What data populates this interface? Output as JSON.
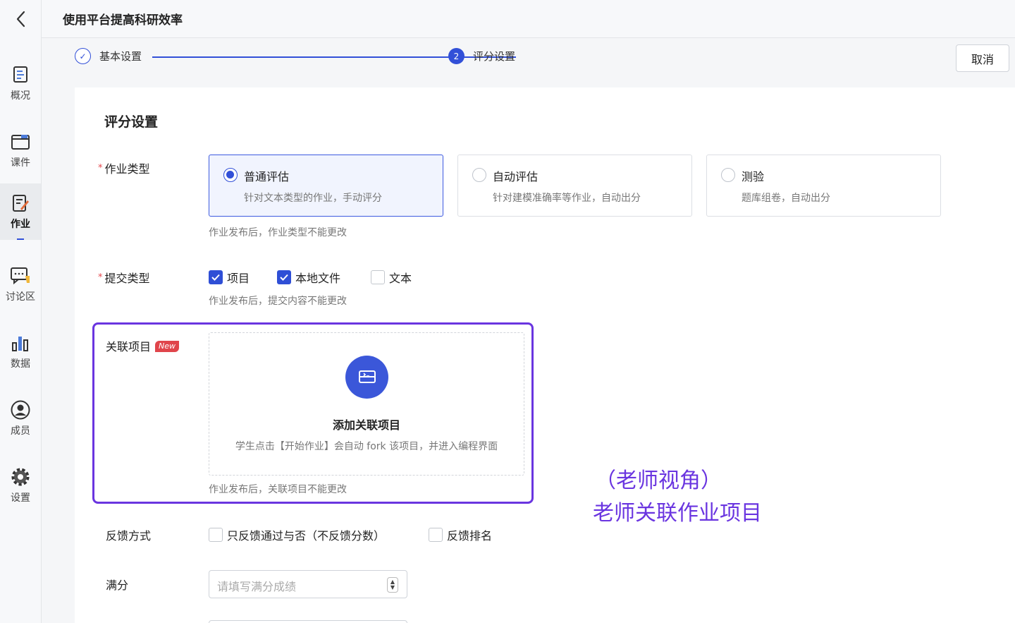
{
  "header": {
    "title": "使用平台提高科研效率"
  },
  "sidebar": {
    "items": [
      {
        "label": "概况",
        "icon": "overview-icon"
      },
      {
        "label": "课件",
        "icon": "courseware-icon"
      },
      {
        "label": "作业",
        "icon": "assignment-icon",
        "active": true
      },
      {
        "label": "讨论区",
        "icon": "discussion-icon"
      },
      {
        "label": "数据",
        "icon": "data-icon"
      },
      {
        "label": "成员",
        "icon": "member-icon"
      },
      {
        "label": "设置",
        "icon": "settings-icon"
      }
    ]
  },
  "steps": [
    {
      "label": "基本设置",
      "state": "done",
      "mark": "✓"
    },
    {
      "label": "评分设置",
      "state": "current",
      "mark": "2"
    }
  ],
  "cancel_label": "取消",
  "form": {
    "section_title": "评分设置",
    "assignment_type": {
      "label": "作业类型",
      "required_mark": "*",
      "options": [
        {
          "title": "普通评估",
          "desc": "针对文本类型的作业，手动评分",
          "selected": true
        },
        {
          "title": "自动评估",
          "desc": "针对建模准确率等作业，自动出分",
          "selected": false
        },
        {
          "title": "测验",
          "desc": "题库组卷，自动出分",
          "selected": false
        }
      ],
      "hint": "作业发布后，作业类型不能更改"
    },
    "submit_type": {
      "label": "提交类型",
      "required_mark": "*",
      "options": [
        {
          "label": "项目",
          "checked": true
        },
        {
          "label": "本地文件",
          "checked": true
        },
        {
          "label": "文本",
          "checked": false
        }
      ],
      "hint": "作业发布后，提交内容不能更改"
    },
    "linked_project": {
      "label": "关联项目",
      "badge": "New",
      "add_title": "添加关联项目",
      "add_desc": "学生点击【开始作业】会自动 fork 该项目，并进入编程界面",
      "hint": "作业发布后，关联项目不能更改"
    },
    "feedback": {
      "label": "反馈方式",
      "options": [
        {
          "label": "只反馈通过与否（不反馈分数）",
          "checked": false
        },
        {
          "label": "反馈排名",
          "checked": false
        }
      ]
    },
    "full_score": {
      "label": "满分",
      "placeholder": "请填写满分成绩"
    }
  },
  "annotation": {
    "line1": "（老师视角）",
    "line2": "老师关联作业项目"
  },
  "colors": {
    "accent": "#3250d8",
    "highlight": "#6a35e0",
    "badge": "#e0454b"
  }
}
